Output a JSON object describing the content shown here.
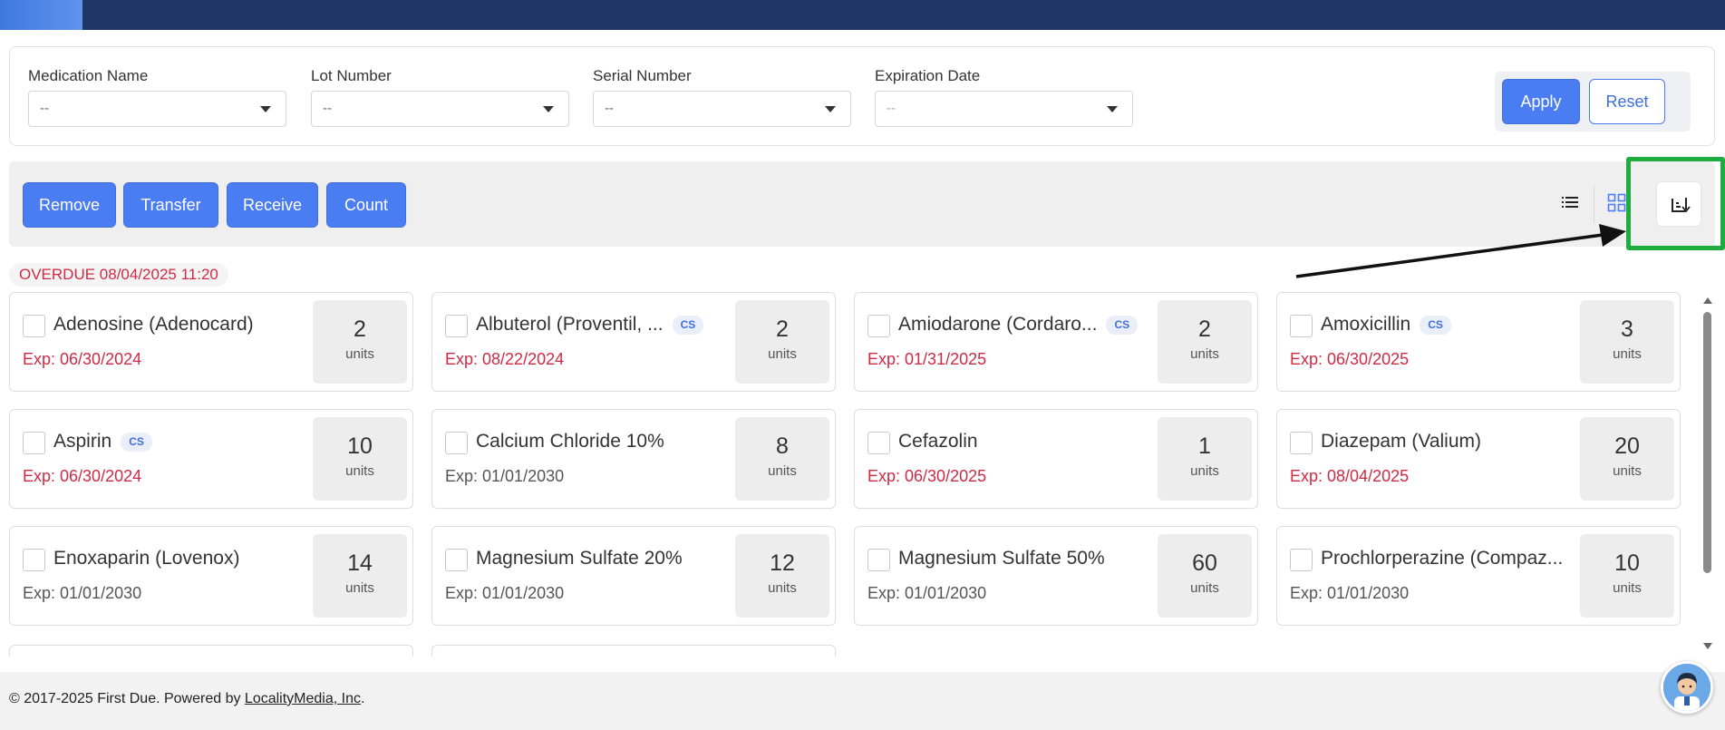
{
  "filters": {
    "medication_name": {
      "label": "Medication Name",
      "value": "--"
    },
    "lot_number": {
      "label": "Lot Number",
      "value": "--"
    },
    "serial_number": {
      "label": "Serial Number",
      "value": "--"
    },
    "expiration_date": {
      "label": "Expiration Date",
      "value": "--"
    },
    "apply_label": "Apply",
    "reset_label": "Reset"
  },
  "actions": {
    "remove": "Remove",
    "transfer": "Transfer",
    "receive": "Receive",
    "count": "Count"
  },
  "view_icons": [
    "list-view-icon",
    "grid-view-icon",
    "sort-icon"
  ],
  "overdue_label": "OVERDUE 08/04/2025 11:20",
  "units_label": "units",
  "cs_label": "CS",
  "items": [
    {
      "name": "Adenosine (Adenocard)",
      "cs": false,
      "exp": "Exp: 06/30/2024",
      "expired": true,
      "qty": "2"
    },
    {
      "name": "Albuterol (Proventil, ...",
      "cs": true,
      "exp": "Exp: 08/22/2024",
      "expired": true,
      "qty": "2"
    },
    {
      "name": "Amiodarone (Cordaro...",
      "cs": true,
      "exp": "Exp: 01/31/2025",
      "expired": true,
      "qty": "2"
    },
    {
      "name": "Amoxicillin",
      "cs": true,
      "exp": "Exp: 06/30/2025",
      "expired": true,
      "qty": "3"
    },
    {
      "name": "Aspirin",
      "cs": true,
      "exp": "Exp: 06/30/2024",
      "expired": true,
      "qty": "10"
    },
    {
      "name": "Calcium Chloride 10%",
      "cs": false,
      "exp": "Exp: 01/01/2030",
      "expired": false,
      "qty": "8"
    },
    {
      "name": "Cefazolin",
      "cs": false,
      "exp": "Exp: 06/30/2025",
      "expired": true,
      "qty": "1"
    },
    {
      "name": "Diazepam (Valium)",
      "cs": false,
      "exp": "Exp: 08/04/2025",
      "expired": true,
      "qty": "20"
    },
    {
      "name": "Enoxaparin (Lovenox)",
      "cs": false,
      "exp": "Exp: 01/01/2030",
      "expired": false,
      "qty": "14"
    },
    {
      "name": "Magnesium Sulfate 20%",
      "cs": false,
      "exp": "Exp: 01/01/2030",
      "expired": false,
      "qty": "12"
    },
    {
      "name": "Magnesium Sulfate 50%",
      "cs": false,
      "exp": "Exp: 01/01/2030",
      "expired": false,
      "qty": "60"
    },
    {
      "name": "Prochlorperazine (Compaz...",
      "cs": false,
      "exp": "Exp: 01/01/2030",
      "expired": false,
      "qty": "10"
    }
  ],
  "footer": {
    "copyright": "© 2017-2025 First Due. Powered by ",
    "link": "LocalityMedia, Inc",
    "suffix": "."
  },
  "colors": {
    "topbar": "#1e3566",
    "primary": "#4a7cf2",
    "overdue": "#d02a44",
    "highlight": "#1fac3f"
  }
}
